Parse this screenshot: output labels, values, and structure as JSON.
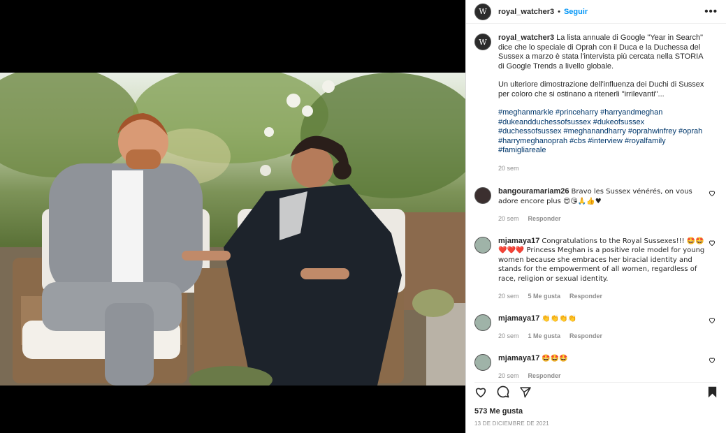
{
  "post": {
    "username": "royal_watcher3",
    "avatar_letter": "W",
    "separator": "•",
    "follow_label": "Seguir",
    "more_icon": "more-options-icon",
    "more_label": "•••",
    "caption_p1": "La lista annuale di Google \"Year in Search\" dice che lo speciale di Oprah con il Duca e la Duchessa del Sussex a marzo è stata l'intervista più cercata nella STORIA di Google Trends a livello globale.",
    "caption_p2": "Un ulteriore dimostrazione dell'influenza dei Duchi di Sussex per coloro che si ostinano a ritenerli \"irrilevanti\"...",
    "hashtags": "#meghanmarkle #princeharry #harryandmeghan #dukeandduchessofsussex #dukeofsussex #duchessofsussex #meghanandharry #oprahwinfrey #oprah #harrymeghanoprah #cbs #interview #royalfamily #famigliareale",
    "caption_time": "20 sem",
    "likes": "573 Me gusta",
    "date": "13 DE DICIEMBRE DE 2021"
  },
  "comments": [
    {
      "user": "bangouramariam26",
      "text": "Bravo les Sussex vénérés, on vous adore encore plus 😍😘🙏👍♥",
      "time": "20 sem",
      "likes": "",
      "reply": "Responder"
    },
    {
      "user": "mjamaya17",
      "text": "Congratulations to the Royal Sussexes!!! 🤩🤩❤️❤️❤️ Princess Meghan is a positive role model for young women because she embraces her biracial identity and stands for the empowerment of all women, regardless of race, religion or sexual identity.",
      "time": "20 sem",
      "likes": "5 Me gusta",
      "reply": "Responder"
    },
    {
      "user": "mjamaya17",
      "text": "👏👏👏👏",
      "time": "20 sem",
      "likes": "1 Me gusta",
      "reply": "Responder"
    },
    {
      "user": "mjamaya17",
      "text": "🤩🤩🤩",
      "time": "20 sem",
      "likes": "",
      "reply": "Responder"
    }
  ],
  "icons": {
    "like": "heart-icon",
    "comment": "comment-icon",
    "share": "share-icon",
    "save": "bookmark-icon"
  },
  "colors": {
    "link": "#0095f6",
    "hashtag": "#00376b",
    "muted": "#8e8e8e"
  }
}
